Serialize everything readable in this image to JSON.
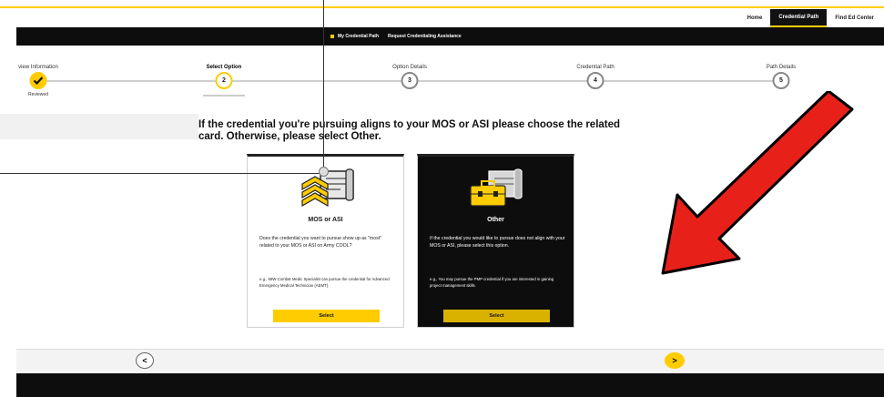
{
  "top_nav": {
    "items": [
      {
        "label": "Home",
        "active": false
      },
      {
        "label": "Credential Path",
        "active": true
      },
      {
        "label": "Find Ed Center",
        "active": false
      }
    ]
  },
  "sub_nav": {
    "items": [
      "My Credential Path",
      "Request Credentialing Assistance"
    ]
  },
  "stepper": {
    "steps": [
      {
        "label": "view Information",
        "number": "",
        "status": "done",
        "sub": "Reviewed"
      },
      {
        "label": "Select Option",
        "number": "2",
        "status": "current",
        "sub": ""
      },
      {
        "label": "Option Details",
        "number": "3",
        "status": "upcoming",
        "sub": ""
      },
      {
        "label": "Credential Path",
        "number": "4",
        "status": "upcoming",
        "sub": ""
      },
      {
        "label": "Path Details",
        "number": "5",
        "status": "upcoming",
        "sub": ""
      }
    ],
    "done_icon": "checkmark-icon"
  },
  "main": {
    "heading": "If the credential you're pursuing aligns to your MOS or ASI please choose the related card. Otherwise, please select Other.",
    "cards": [
      {
        "title": "MOS or ASI",
        "icon": "rank-chevron-certificate-icon",
        "description": "Does the credential you want to pursue show up as \"most\" related to your MOS or ASI on Army COOL?",
        "example": "e.g., 68W Combat Medic Specialist can pursue the credential for Advanced Emergency Medical Technician (AEMT).",
        "button": "Select"
      },
      {
        "title": "Other",
        "icon": "briefcase-certificate-icon",
        "description": "If the credential you would like to pursue does not align with your MOS or ASI, please select this option.",
        "example": "e.g., You may pursue the PMP credential if you are interested in gaining project management skills.",
        "button": "Select"
      }
    ]
  },
  "pager": {
    "prev": "<",
    "next": ">"
  },
  "colors": {
    "accent": "#ffcc01",
    "dark": "#0d0d0d",
    "annotation_arrow": "#e8201a"
  }
}
